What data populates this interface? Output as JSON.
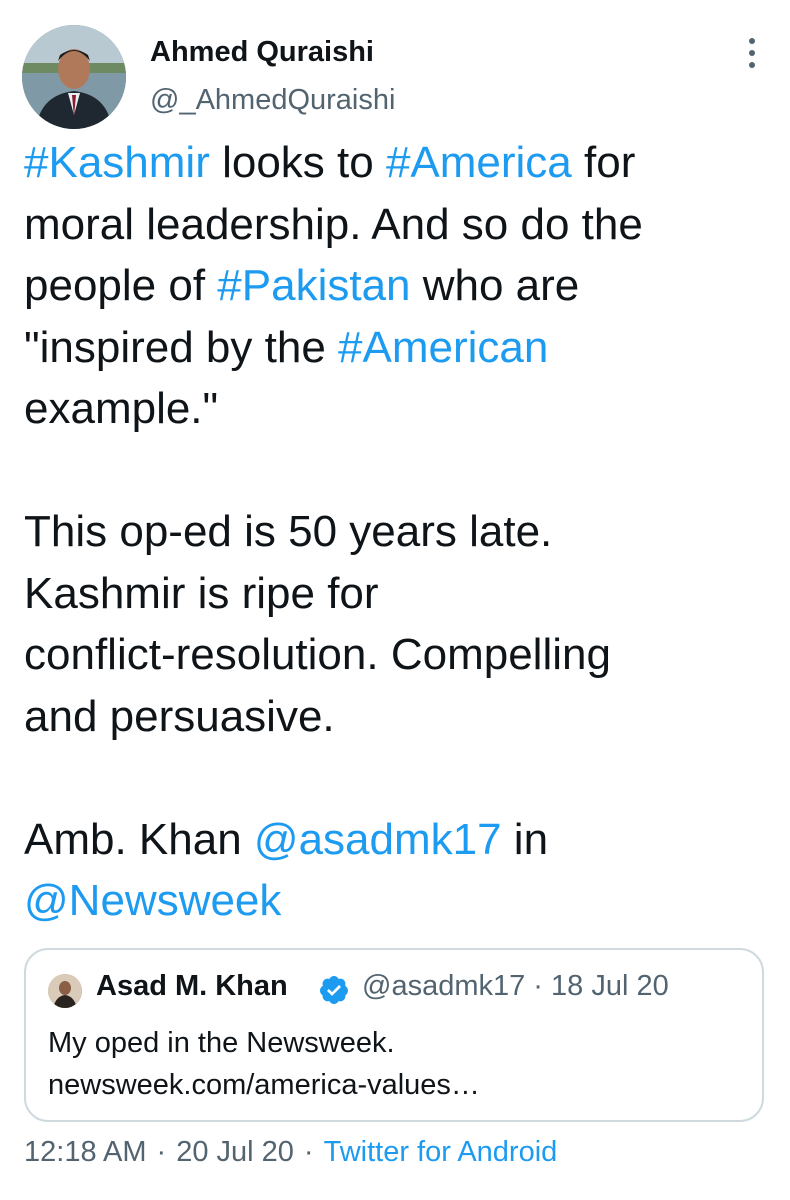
{
  "author": {
    "name": "Ahmed Quraishi",
    "handle": "@_AhmedQuraishi"
  },
  "tweet": {
    "segments": [
      {
        "text": "#Kashmir",
        "link": true
      },
      {
        "text": " looks to ",
        "link": false
      },
      {
        "text": "#America",
        "link": true
      },
      {
        "text": " for\nmoral leadership. And so do the\npeople of ",
        "link": false
      },
      {
        "text": "#Pakistan",
        "link": true
      },
      {
        "text": " who are\n\"inspired by the ",
        "link": false
      },
      {
        "text": "#American",
        "link": true
      },
      {
        "text": "\nexample.\"\n\nThis op-ed is 50 years late.\nKashmir is ripe for\nconflict-resolution. Compelling\nand persuasive.\n\nAmb. Khan ",
        "link": false
      },
      {
        "text": "@asadmk17",
        "link": true
      },
      {
        "text": " in\n",
        "link": false
      },
      {
        "text": "@Newsweek",
        "link": true
      }
    ]
  },
  "quoted_tweet": {
    "name": "Asad M. Khan",
    "meta": "@asadmk17 · 18 Jul 20",
    "line1": "My oped in the Newsweek.",
    "line2": "newsweek.com/america-values…"
  },
  "footer": {
    "time": "12:18 AM",
    "sep1": "·",
    "date": "20 Jul 20",
    "sep2": "·",
    "source": "Twitter for Android"
  },
  "icons": {
    "more": "more-vertical-icon",
    "verified": "verified-badge-icon"
  },
  "colors": {
    "link": "#1d9bf0",
    "secondary_text": "#536471",
    "border": "#cfd9de",
    "text": "#0f1419"
  }
}
